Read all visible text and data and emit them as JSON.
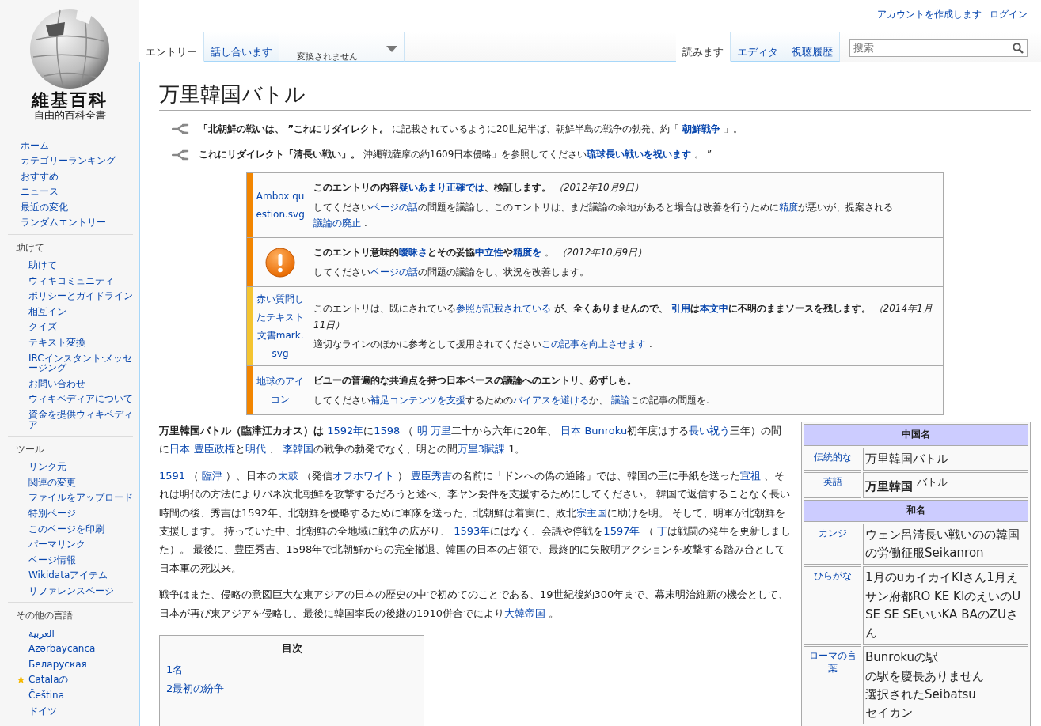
{
  "logo": {
    "title": "維基百科",
    "subtitle": "自由的百科全書"
  },
  "personal": [
    "アカウントを作成します",
    "ログイン"
  ],
  "left_tabs": [
    {
      "label": "エントリー",
      "selected": true
    },
    {
      "label": "話し合います",
      "selected": false
    }
  ],
  "variants": {
    "label": "変換されません"
  },
  "right_tabs": [
    {
      "label": "読みます",
      "selected": true
    },
    {
      "label": "エディタ",
      "selected": false
    },
    {
      "label": "視聴履歴",
      "selected": false
    }
  ],
  "search": {
    "placeholder": "搜索"
  },
  "sidebar": [
    {
      "items": [
        {
          "label": "ホーム"
        },
        {
          "label": "カテゴリーランキング"
        },
        {
          "label": "おすすめ"
        },
        {
          "label": "ニュース"
        },
        {
          "label": "最近の変化"
        },
        {
          "label": "ランダムエントリー"
        }
      ]
    },
    {
      "heading": "助けて",
      "items": [
        {
          "label": "助けて"
        },
        {
          "label": "ウィキコミュニティ"
        },
        {
          "label": "ポリシーとガイドライン"
        },
        {
          "label": "相互イン"
        },
        {
          "label": "クイズ"
        },
        {
          "label": "テキスト変換"
        },
        {
          "label": "IRCインスタント·メッセージング"
        },
        {
          "label": "お問い合わせ"
        },
        {
          "label": "ウィキペディアについて"
        },
        {
          "label": "資金を提供ウィキペディア"
        }
      ]
    },
    {
      "heading": "ツール",
      "items": [
        {
          "label": "リンク元"
        },
        {
          "label": "関連の変更"
        },
        {
          "label": "ファイルをアップロード"
        },
        {
          "label": "特別ページ"
        },
        {
          "label": "このページを印刷"
        },
        {
          "label": "パーマリンク"
        },
        {
          "label": "ページ情報"
        },
        {
          "label": "Wikidataアイテム"
        },
        {
          "label": "リファレンスページ"
        }
      ]
    },
    {
      "heading": "その他の言語",
      "items": [
        {
          "label": "العربية",
          "featured": false
        },
        {
          "label": "Azərbaycanca",
          "featured": false
        },
        {
          "label": "Беларуская",
          "featured": false
        },
        {
          "label": "Catalaの",
          "featured": true
        },
        {
          "label": "Čeština",
          "featured": false
        },
        {
          "label": "ドイツ",
          "featured": false
        }
      ]
    }
  ],
  "title": "万里韓国バトル",
  "hatnotes": [
    [
      "**「北朝鮮の戦いは、 ”これにリダイレクト。** に記載されているように20世紀半ば、朝鮮半島の戦争の勃発、約「 ",
      {
        "link": "**朝鮮戦争**"
      },
      " 」。"
    ],
    [
      "**これにリダイレクト「清長い戦い」。** 沖縄戦薩摩の約1609日本侵略」を参照してください",
      {
        "link": "**琉球長い戦いを祝います**"
      },
      " 。 ”"
    ]
  ],
  "notices": [
    {
      "color": "#f28500",
      "image": {
        "kind": "alt",
        "text": "Ambox question.svg"
      },
      "paragraphs": [
        [
          "**このエントリの内容**",
          {
            "link": "**疑いあまり正確では**"
          },
          "**、検証します。** *（2012年10月9日）*"
        ],
        [
          "してください",
          {
            "link": "ページの話"
          },
          "の問題を議論し、このエントリは、まだ議論の余地があると場合は改善を行うために",
          {
            "link": "精度"
          },
          "が悪いが、提案される",
          {
            "link": "議論の廃止"
          },
          " ."
        ]
      ]
    },
    {
      "color": "#f28500",
      "image": {
        "kind": "icon"
      },
      "paragraphs": [
        [
          "**このエントリ意味的**",
          {
            "link": "**曖昧さ**"
          },
          "**とその妥協**",
          {
            "link": "**中立性**"
          },
          "**や**",
          {
            "link": "**精度を**"
          },
          " 。 *（2012年10月9日）*"
        ],
        [
          "してください",
          {
            "link": "ページの話"
          },
          "の問題の議論をし、状況を改善します。"
        ]
      ]
    },
    {
      "color": "#f4c430",
      "image": {
        "kind": "alt",
        "text": "赤い質問したテキスト文書mark.svg"
      },
      "paragraphs": [
        [
          "このエントリは、既にされている",
          {
            "link": "参照が記載されている"
          },
          " **が、全くありませんので、** ",
          {
            "link": "**引用**"
          },
          "**は**",
          {
            "link": "**本文中**"
          },
          "**に不明のままソースを残します。** *（2014年1月11日）*"
        ],
        [
          "適切なラインのほかに参考として援用されてください",
          {
            "link": "この記事を向上させます"
          },
          " ."
        ]
      ]
    },
    {
      "color": "#f28500",
      "image": {
        "kind": "alt",
        "text": "地球のアイコン"
      },
      "paragraphs": [
        [
          "**ビユーの普遍的な共通点を持つ日本ベースの議論へのエントリ、必ずしも。**"
        ],
        [
          "してください",
          {
            "link": "補足コンテンツを支援"
          },
          "するための",
          {
            "link": "バイアスを避ける"
          },
          "か、 ",
          {
            "link": "議論"
          },
          "この記事の問題を."
        ]
      ]
    }
  ],
  "infobox": [
    {
      "kind": "header",
      "text": "中国名"
    },
    {
      "kind": "row",
      "label": "伝統的な",
      "lines": [
        "万里韓国バトル"
      ]
    },
    {
      "kind": "row",
      "label": "英語",
      "lines": [
        "**万里韓国** $^{バトル}$"
      ]
    },
    {
      "kind": "header",
      "text": "和名"
    },
    {
      "kind": "row",
      "label": "カンジ",
      "lines": [
        "ウェン呂清長い戦いのの韓国の労働征服Seikanron"
      ]
    },
    {
      "kind": "row",
      "label": "ひらがな",
      "lines": [
        "1月のuカイカイKIさん1月えサン府都RO KE KIのえいのU SE SE SEいいKA BAのZUさん"
      ]
    },
    {
      "kind": "row",
      "label": "ローマの言葉",
      "lines": [
        "Bunrokuの駅",
        "の駅を慶長ありません",
        "選択されたSeibatsu",
        "セイカン"
      ]
    }
  ],
  "paragraphs": [
    [
      "**万里韓国バトル（臨津江カオス）は** ",
      {
        "link": "1592年"
      },
      "に",
      {
        "link": "1598"
      },
      " （ ",
      {
        "link": "明"
      },
      {
        "link": "万里"
      },
      "二十から六年に20年、 ",
      {
        "link": "日本"
      },
      {
        "link": "Bunroku"
      },
      "初年度はする",
      {
        "link": "長い祝う"
      },
      "三年）の間に",
      {
        "link": "日本"
      },
      {
        "link": "豊臣政権"
      },
      "と",
      {
        "link": "明代"
      },
      " 、 ",
      {
        "link": "李韓国"
      },
      "の戦争の勃発でなく、明との間",
      {
        "link": "万里3賦課"
      },
      " 1。"
    ],
    [
      {
        "link": "1591"
      },
      " （ ",
      {
        "link": "臨津"
      },
      " ）、日本の",
      {
        "link": "太鼓"
      },
      " （発信",
      {
        "link": "オフホワイト"
      },
      " ） ",
      {
        "link": "豊臣秀吉"
      },
      "の名前に「ドンへの偽の通路」では、韓国の王に手紙を送った",
      {
        "link": "宣祖"
      },
      " 、それは明代の方法によりバネ次北朝鮮を攻撃するだろうと述べ、李ヤン要件を支援するためにしてください。 韓国で返信することなく長い時間の後、秀吉は1592年、北朝鮮を侵略するために軍隊を送った、北朝鮮は着実に、敗北",
      {
        "link": "宗主国"
      },
      "に助けを明。 そして、明軍が北朝鮮を支援します。 持っていた中、北朝鮮の全地域に戦争の広がり、 ",
      {
        "link": "1593年"
      },
      "にはなく、会議や停戦を",
      {
        "link": "1597年"
      },
      " （ ",
      {
        "link": "丁"
      },
      "は戦闘の発生を更新しました）。 最後に、豊臣秀吉、1598年で北朝鮮からの完全撤退、韓国の日本の占領で、最終的に失敗明アクションを攻撃する踏み台として日本軍の死以来。"
    ],
    [
      "戦争はまた、侵略の意図巨大な東アジアの日本の歴史の中で初めてのことである、19世紀後約300年まで、幕末明治維新の機会として、日本が再び東アジアを侵略し、最後に韓国李氏の後継の1910併合でにより",
      {
        "link": "大韓帝国"
      },
      " 。"
    ]
  ],
  "toc": {
    "title": "目次",
    "items": [
      {
        "label": "1名"
      },
      {
        "label": "2最初の紛争"
      }
    ]
  }
}
